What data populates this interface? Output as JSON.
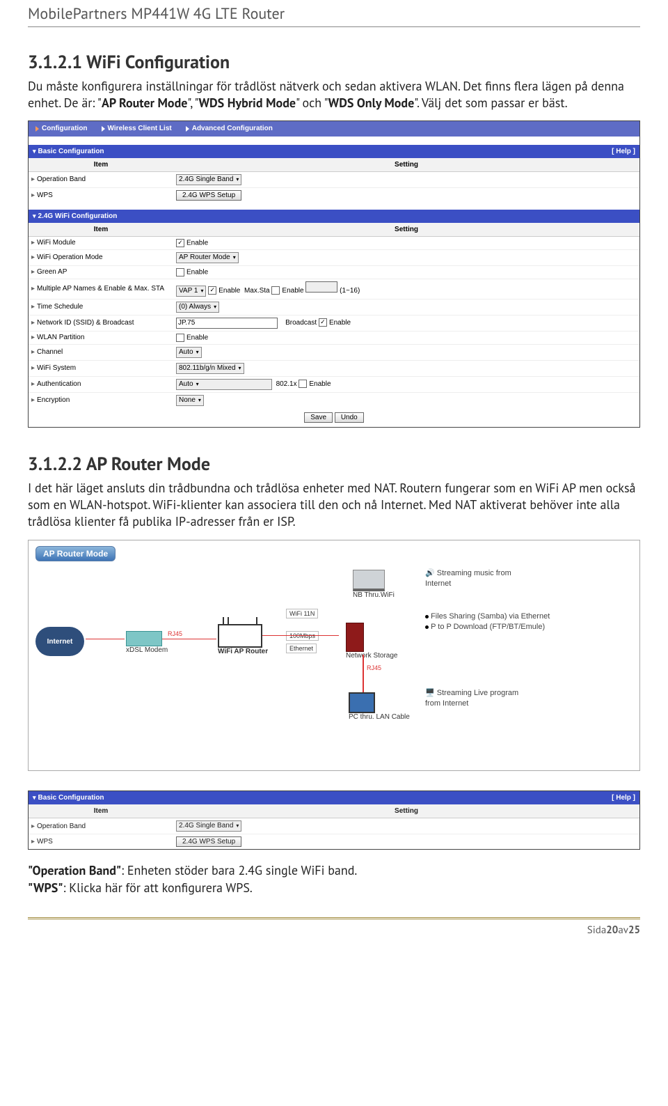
{
  "doc_title": "MobilePartners MP441W 4G LTE Router",
  "sec1": {
    "heading": "3.1.2.1 WiFi Configuration",
    "p1a": "Du måste konfigurera inställningar för trådlöst nätverk och sedan aktivera WLAN. Det finns flera lägen på denna enhet. De är: \"",
    "b1": "AP Router Mode",
    "p1b": "\", \"",
    "b2": "WDS Hybrid Mode",
    "p1c": "\" och \"",
    "b3": "WDS Only Mode",
    "p1d": "\". Välj det som passar er bäst."
  },
  "shot1": {
    "tabs": [
      "Configuration",
      "Wireless Client List",
      "Advanced Configuration"
    ],
    "basic_hdr": "Basic Configuration",
    "help": "[ Help ]",
    "col_item": "Item",
    "col_setting": "Setting",
    "r_opband": "Operation Band",
    "v_opband": "2.4G Single Band",
    "r_wps": "WPS",
    "v_wps": "2.4G WPS Setup",
    "wifi_hdr": "2.4G WiFi Configuration",
    "r_module": "WiFi Module",
    "lbl_enable": "Enable",
    "r_opmode": "WiFi Operation Mode",
    "v_opmode": "AP Router Mode",
    "r_greenap": "Green AP",
    "r_multi": "Multiple AP Names & Enable & Max. STA",
    "v_vap": "VAP 1",
    "lbl_maxsta": "Max.Sta",
    "lbl_116": "(1~16)",
    "r_sched": "Time Schedule",
    "v_sched": "(0) Always",
    "r_ssid": "Network ID (SSID) & Broadcast",
    "v_ssid": "JP.75",
    "lbl_broadcast": "Broadcast",
    "r_part": "WLAN Partition",
    "r_chan": "Channel",
    "v_chan": "Auto",
    "r_sys": "WiFi System",
    "v_sys": "802.11b/g/n Mixed",
    "r_auth": "Authentication",
    "v_auth": "Auto",
    "lbl_8021x": "802.1x",
    "r_enc": "Encryption",
    "v_enc": "None",
    "btn_save": "Save",
    "btn_undo": "Undo"
  },
  "sec2": {
    "heading": "3.1.2.2 AP Router Mode",
    "p": "I det här läget ansluts din trådbundna och trådlösa enheter med NAT. Routern fungerar som en WiFi AP men också som en WLAN-hotspot. WiFi-klienter kan associera till den och nå Internet. Med NAT aktiverat behöver inte alla trådlösa klienter få publika IP-adresser från er ISP."
  },
  "diagram": {
    "badge": "AP Router Mode",
    "internet": "Internet",
    "modem": "xDSL Modem",
    "router": "WiFi AP Router",
    "nas": "Network Storage",
    "nb": "NB Thru.WiFi",
    "pc": "PC thru. LAN Cable",
    "rj45": "RJ45",
    "wifi11n": "WiFi 11N",
    "mbps": "100Mbps",
    "eth": "Ethernet",
    "stream": "Streaming music from Internet",
    "files": "Files Sharing (Samba) via Ethernet",
    "p2p": "P to P Download (FTP/BT/Emule)",
    "live": "Streaming Live program from Internet"
  },
  "shot2": {
    "hdr": "Basic Configuration",
    "help": "[ Help ]",
    "col_item": "Item",
    "col_setting": "Setting",
    "r_opband": "Operation Band",
    "v_opband": "2.4G Single Band",
    "r_wps": "WPS",
    "v_wps": "2.4G WPS Setup"
  },
  "tail": {
    "t1": "\"Operation Band\"",
    "t1b": ": Enheten stöder bara 2.4G single WiFi band.",
    "t2": "\"WPS\"",
    "t2b": ": Klicka här för att konfigurera WPS."
  },
  "footer": {
    "pre": "Sida ",
    "num": "20",
    "mid": " av ",
    "tot": "25"
  }
}
